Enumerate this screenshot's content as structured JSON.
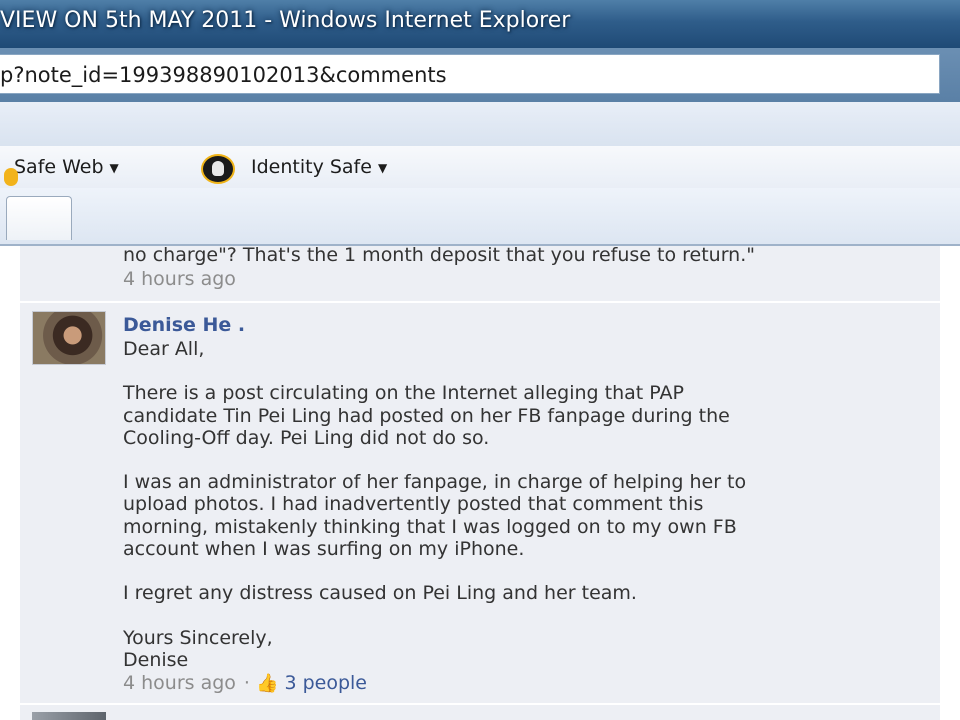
{
  "window": {
    "title": "VIEW ON 5th MAY 2011 - Windows Internet Explorer"
  },
  "address_bar": {
    "url": "p?note_id=199398890102013&comments"
  },
  "norton_toolbar": {
    "safe_web_label": "Safe Web",
    "identity_safe_label": "Identity Safe"
  },
  "previous_comment": {
    "text_tail": "no charge\"? That's the 1 month deposit that you refuse to return.\"",
    "timestamp": "4 hours ago"
  },
  "comment": {
    "author": "Denise He",
    "author_suffix": ".",
    "body": "Dear All,\n\nThere is a post circulating on the Internet alleging that PAP\ncandidate Tin Pei Ling had posted on her FB fanpage during the\nCooling-Off day. Pei Ling did not do so.\n\nI was an administrator of her fanpage, in charge of helping her to\nupload photos. I had inadvertently posted that comment this\nmorning, mistakenly thinking that I was logged on to my own FB\naccount when I was surfing on my iPhone.\n\nI regret any distress caused on Pei Ling and her team.\n\nYours Sincerely,\nDenise",
    "timestamp": "4 hours ago",
    "separator": "·",
    "likes": "3 people"
  },
  "icons": {
    "like": "thumbs-up-icon",
    "identity": "identity-safe-icon",
    "safe_web": "safe-web-icon"
  }
}
